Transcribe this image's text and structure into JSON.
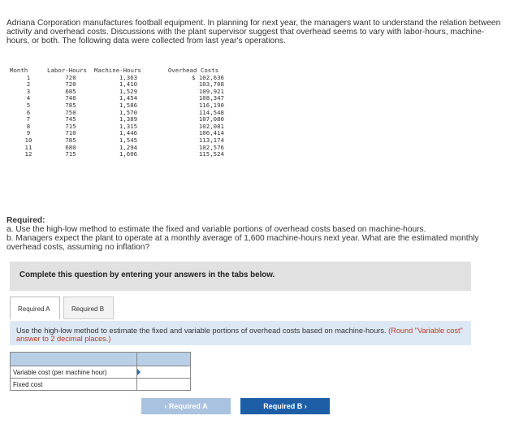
{
  "intro": {
    "text": "Adriana Corporation manufactures football equipment. In planning for next year, the managers want to understand the relation between activity and overhead costs. Discussions with the plant supervisor suggest that overhead seems to vary with labor-hours, machine-hours, or both. The following data were collected from last year's operations."
  },
  "table": {
    "headers": [
      "Month",
      "Labor-Hours",
      "Machine-Hours",
      "Overhead Costs"
    ],
    "rows": [
      [
        "1",
        "720",
        "1,363",
        "$ 102,636"
      ],
      [
        "2",
        "720",
        "1,410",
        "103,708"
      ],
      [
        "3",
        "685",
        "1,529",
        "109,921"
      ],
      [
        "4",
        "740",
        "1,454",
        "108,347"
      ],
      [
        "5",
        "785",
        "1,586",
        "116,190"
      ],
      [
        "6",
        "750",
        "1,570",
        "114,548"
      ],
      [
        "7",
        "745",
        "1,389",
        "107,080"
      ],
      [
        "8",
        "715",
        "1,315",
        "102,081"
      ],
      [
        "9",
        "710",
        "1,446",
        "106,414"
      ],
      [
        "10",
        "785",
        "1,545",
        "113,174"
      ],
      [
        "11",
        "680",
        "1,294",
        "102,576"
      ],
      [
        "12",
        "715",
        "1,606",
        "115,524"
      ]
    ]
  },
  "required": {
    "title": "Required:",
    "a": "a. Use the high-low method to estimate the fixed and variable portions of overhead costs based on machine-hours.",
    "b": "b. Managers expect the plant to operate at a monthly average of 1,600 machine-hours next year. What are the estimated monthly overhead costs, assuming no inflation?"
  },
  "complete_bar": "Complete this question by entering your answers in the tabs below.",
  "tabs": [
    {
      "label": "Required A"
    },
    {
      "label": "Required B"
    }
  ],
  "instruction": {
    "text": "Use the high-low method to estimate the fixed and variable portions of overhead costs based on machine-hours.",
    "red": "(Round \"Variable cost\" answer to 2 decimal places.)"
  },
  "answers": {
    "rows": [
      {
        "label": "Variable cost (per machine hour)",
        "value": ""
      },
      {
        "label": "Fixed cost",
        "value": ""
      }
    ]
  },
  "nav": {
    "prev": "‹  Required A",
    "next": "Required B  ›"
  },
  "colors": {
    "accent": "#1d5fa7",
    "disabled": "#a9c2df",
    "instruction_bg": "#dce9f5",
    "header_cell": "#b8cfe6",
    "red_note": "#c0392b"
  }
}
